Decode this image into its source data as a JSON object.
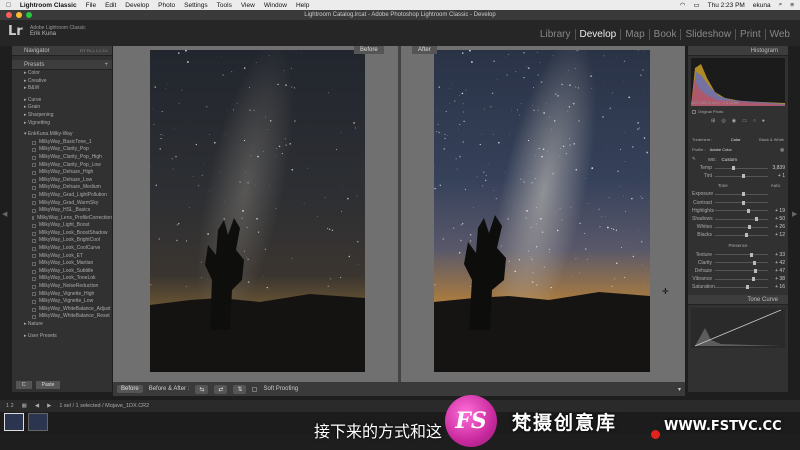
{
  "menubar": {
    "apple_icon": "apple-icon",
    "app_name": "Lightroom Classic",
    "items": [
      "File",
      "Edit",
      "Develop",
      "Photo",
      "Settings",
      "Tools",
      "View",
      "Window",
      "Help"
    ],
    "clock": "Thu 2:23 PM",
    "user": "ekuna"
  },
  "titlebar": {
    "title": "Lightroom Catalog.lrcat - Adobe Photoshop Lightroom Classic - Develop"
  },
  "identity": {
    "logo": "Lr",
    "line1": "Adobe Lightroom Classic",
    "line2": "Erik Kuna"
  },
  "modules": [
    "Library",
    "Develop",
    "Map",
    "Book",
    "Slideshow",
    "Print",
    "Web"
  ],
  "active_module": "Develop",
  "left_panel": {
    "navigator_label": "Navigator",
    "navigator_zoom": "FIT  FILL  1:1  3:1",
    "presets_label": "Presets",
    "groups_top": [
      "Color",
      "Creative",
      "B&W"
    ],
    "groups_mid": [
      "Curve",
      "Grain",
      "Sharpening",
      "Vignetting"
    ],
    "user_group": "EnkKuna.Milky-Way",
    "presets": [
      "MilkyWay_BasicTone_1",
      "MilkyWay_Clarity_Pop",
      "MilkyWay_Clarity_Pop_High",
      "MilkyWay_Clarity_Pop_Low",
      "MilkyWay_Dehaze_High",
      "MilkyWay_Dehaze_Low",
      "MilkyWay_Dehaze_Medium",
      "MilkyWay_Grad_LightPollution",
      "MilkyWay_Grad_WarmSky",
      "MilkyWay_HSL_Basics",
      "MilkyWay_Lens_ProfileCorrection",
      "MilkyWay_Light_Boost",
      "MilkyWay_Look_BoostShadow",
      "MilkyWay_Look_BrightCool",
      "MilkyWay_Look_CoolCurve",
      "MilkyWay_Look_ET",
      "MilkyWay_Look_Martian",
      "MilkyWay_Look_Subtitle",
      "MilkyWay_Look_ToneLok",
      "MilkyWay_NoiseReduction",
      "MilkyWay_Vignette_High",
      "MilkyWay_Vignette_Low",
      "MilkyWay_WhiteBalance_Adjust",
      "MilkyWay_WhiteBalance_Reset"
    ],
    "nature_group": "Nature",
    "user_presets": "User Presets",
    "copy_btn": "C",
    "paste_btn": "Paste"
  },
  "center": {
    "before_label": "Before",
    "after_label": "After"
  },
  "toolbar": {
    "view_btn": "Before",
    "before_after_label": "Before & After :",
    "soft_proofing": "Soft Proofing"
  },
  "right_panel": {
    "histogram_label": "Histogram",
    "histogram_info": "ISO 1,600   11 mm   f / 2.8   15 sec",
    "original_photo": "Original Photo",
    "treatment_label": "Treatment :",
    "treatment_color": "Color",
    "treatment_bw": "Black & White",
    "profile_label": "Profile :",
    "profile_value": "Adobe Color",
    "wb_label": "WB :",
    "wb_value": "Custom",
    "tone_label": "Tone",
    "auto_label": "Auto",
    "presence_label": "Presence",
    "tone_curve_label": "Tone Curve",
    "sliders_wb": [
      {
        "label": "Temp",
        "value": "3,839",
        "pos": 0.33
      },
      {
        "label": "Tint",
        "value": "+ 1",
        "pos": 0.5
      }
    ],
    "sliders_tone": [
      {
        "label": "Exposure",
        "value": "",
        "pos": 0.5
      },
      {
        "label": "Contrast",
        "value": "",
        "pos": 0.5
      },
      {
        "label": "Highlights",
        "value": "+ 19",
        "pos": 0.6
      },
      {
        "label": "Shadows",
        "value": "+ 50",
        "pos": 0.75
      },
      {
        "label": "Whites",
        "value": "+ 26",
        "pos": 0.63
      },
      {
        "label": "Blacks",
        "value": "+ 12",
        "pos": 0.56
      }
    ],
    "sliders_presence": [
      {
        "label": "Texture",
        "value": "+ 33",
        "pos": 0.66
      },
      {
        "label": "Clarity",
        "value": "+ 42",
        "pos": 0.71
      },
      {
        "label": "Dehaze",
        "value": "+ 47",
        "pos": 0.73
      },
      {
        "label": "Vibrance",
        "value": "+ 38",
        "pos": 0.69
      },
      {
        "label": "Saturation",
        "value": "+ 16",
        "pos": 0.58
      }
    ]
  },
  "filmstrip": {
    "info": "1 sel / 1 selected / Mojave_1DX.CR2",
    "page": "1  2"
  },
  "overlay": {
    "subtitle": "接下来的方式和这",
    "watermark_badge": "FS",
    "watermark_text": "梵摄创意库",
    "watermark_url": "WWW.FSTVC.CC"
  },
  "colors": {
    "accent_bg": "#262626",
    "panel_bg": "#313131",
    "watermark_pink": "#c92a9e",
    "record_red": "#e2231a"
  }
}
